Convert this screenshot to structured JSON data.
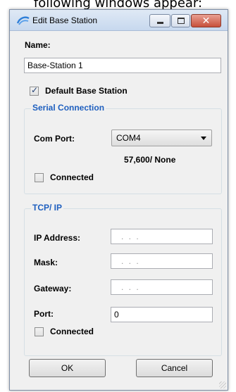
{
  "caption": "following windows appear:",
  "window": {
    "title": "Edit Base Station",
    "close_glyph": "✕"
  },
  "name_section": {
    "label": "Name:",
    "value": "Base-Station 1"
  },
  "default_checkbox": {
    "label": "Default Base Station",
    "checked": true
  },
  "serial": {
    "title": "Serial Connection",
    "com_port_label": "Com Port:",
    "com_port_value": "COM4",
    "baud_parity": "57,600/ None",
    "connected_label": "Connected",
    "connected_checked": false
  },
  "tcpip": {
    "title": "TCP/ IP",
    "ip_label": "IP Address:",
    "ip_value": ". . .",
    "mask_label": "Mask:",
    "mask_value": ". . .",
    "gateway_label": "Gateway:",
    "gateway_value": ". . .",
    "port_label": "Port:",
    "port_value": "0",
    "connected_label": "Connected",
    "connected_checked": false
  },
  "buttons": {
    "ok_label": "OK",
    "cancel_label": "Cancel"
  },
  "colors": {
    "group_title": "#1e5fbf",
    "dialog_bg": "#f0f0f0",
    "close_button": "#c7503b"
  }
}
